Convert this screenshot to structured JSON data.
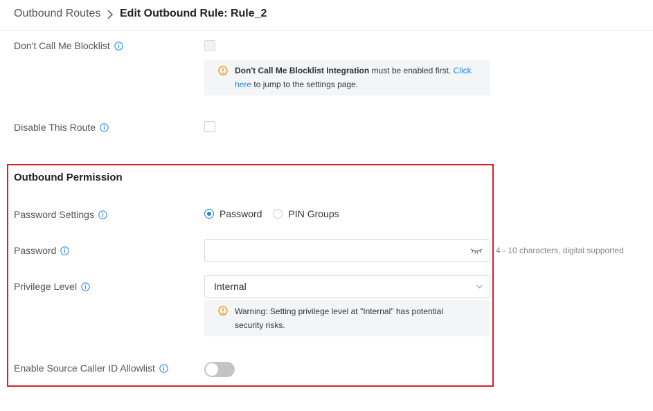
{
  "breadcrumb": {
    "parent": "Outbound Routes",
    "current": "Edit Outbound Rule: Rule_2"
  },
  "dont_call_blocklist": {
    "label": "Don't Call Me Blocklist",
    "notice_bold": "Don't Call Me Blocklist Integration",
    "notice_middle": " must be enabled first. ",
    "notice_link_1": "Click",
    "notice_link_2": "here",
    "notice_end": " to jump to the settings page."
  },
  "disable_route": {
    "label": "Disable This Route"
  },
  "outbound_permission": {
    "title": "Outbound Permission",
    "password_settings": {
      "label": "Password Settings",
      "options": [
        "Password",
        "PIN Groups"
      ],
      "selected": "Password"
    },
    "password": {
      "label": "Password",
      "value": "",
      "hint": "4 - 10 characters, digital supported"
    },
    "privilege_level": {
      "label": "Privilege Level",
      "value": "Internal",
      "warning_line1": "Warning: Setting privilege level at \"Internal\" has potential",
      "warning_line2": "security risks."
    },
    "source_caller_allowlist": {
      "label": "Enable Source Caller ID Allowlist",
      "enabled": false
    }
  },
  "colors": {
    "accent": "#1e88e5",
    "warning": "#f08c00",
    "highlight_border": "#d81e2a"
  }
}
